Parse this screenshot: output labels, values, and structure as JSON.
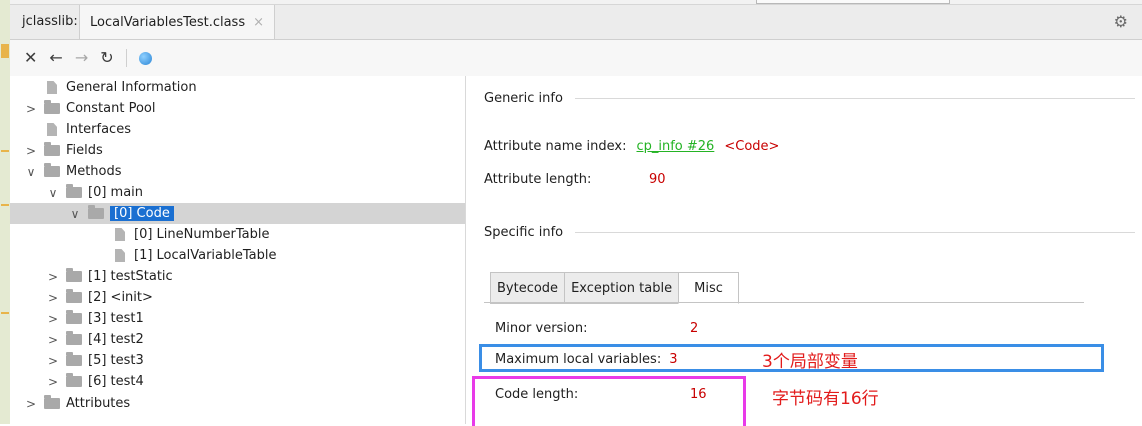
{
  "tabbar": {
    "prefix": "jclasslib:",
    "file_tab": "LocalVariablesTest.class",
    "close_glyph": "×",
    "settings_icon": "gear-icon"
  },
  "toolbar": {
    "close": "✕",
    "back": "←",
    "forward": "→",
    "refresh": "↻",
    "web_icon": "globe-icon"
  },
  "tree": {
    "general": "General Information",
    "constant_pool": "Constant Pool",
    "interfaces": "Interfaces",
    "fields": "Fields",
    "methods": "Methods",
    "main": "[0] main",
    "code": "[0] Code",
    "line_number_table": "[0] LineNumberTable",
    "local_variable_table": "[1] LocalVariableTable",
    "test_static": "[1] testStatic",
    "init": "[2] <init>",
    "test1": "[3] test1",
    "test2": "[4] test2",
    "test3": "[5] test3",
    "test4": "[6] test4",
    "attributes": "Attributes",
    "arrow_expanded": "∨",
    "arrow_collapsed": ">"
  },
  "detail": {
    "generic_title": "Generic info",
    "name_index_label": "Attribute name index:",
    "name_index_link": "cp_info #26",
    "name_index_value": "<Code>",
    "length_label": "Attribute length:",
    "length_value": "90",
    "specific_title": "Specific info",
    "tabs": [
      "Bytecode",
      "Exception table",
      "Misc"
    ],
    "minor_label": "Minor version:",
    "minor_value": "2",
    "max_locals_label": "Maximum local variables:",
    "max_locals_value": "3",
    "code_length_label": "Code length:",
    "code_length_value": "16"
  },
  "annotations": {
    "locals_note": "3个局部变量",
    "code_note": "字节码有16行"
  },
  "colors": {
    "selection": "#1a6fd1",
    "value_red": "#c80000",
    "link_green": "#24b324",
    "blue_box": "#3a8ee6",
    "magenta_box": "#e83ae8"
  }
}
